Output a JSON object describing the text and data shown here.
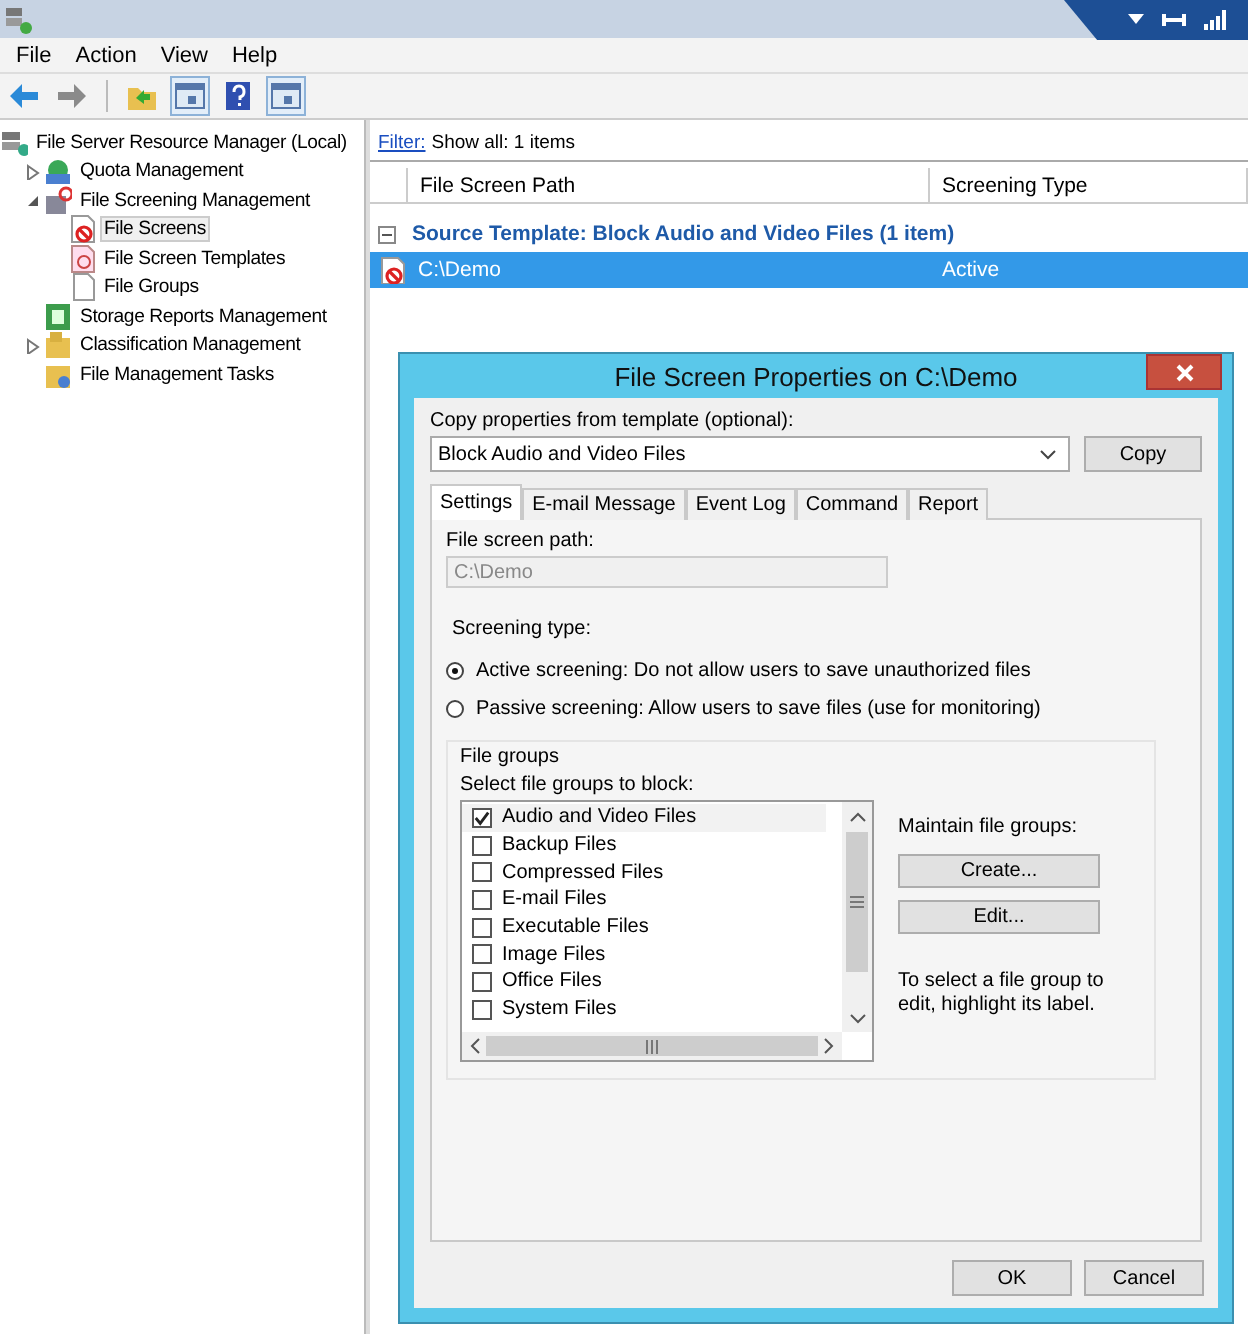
{
  "menu": [
    "File",
    "Action",
    "View",
    "Help"
  ],
  "toolbar": [
    {
      "kind": "back"
    },
    {
      "kind": "forward"
    },
    {
      "kind": "sep"
    },
    {
      "kind": "folder"
    },
    {
      "kind": "pane"
    },
    {
      "kind": "help"
    },
    {
      "kind": "pane"
    }
  ],
  "tree": [
    {
      "label": "File Server Resource Manager (Local)",
      "kind": "server",
      "selected": false,
      "children": [
        {
          "label": "Quota Management",
          "kind": "quota",
          "expanded": false,
          "selected": false
        },
        {
          "label": "File Screening Management",
          "kind": "screening",
          "expanded": true,
          "selected": false,
          "children": [
            {
              "label": "File Screens",
              "kind": "screen",
              "selected": true
            },
            {
              "label": "File Screen Templates",
              "kind": "template",
              "selected": false
            },
            {
              "label": "File Groups",
              "kind": "page",
              "selected": false
            }
          ]
        },
        {
          "label": "Storage Reports Management",
          "kind": "reports",
          "selected": false
        },
        {
          "label": "Classification Management",
          "kind": "classify",
          "expanded": false,
          "selected": false
        },
        {
          "label": "File Management Tasks",
          "kind": "tasks",
          "selected": false
        }
      ]
    }
  ],
  "filter": {
    "link": "Filter:",
    "text": "Show all: 1 items"
  },
  "table": {
    "columns": [
      "File Screen Path",
      "Screening Type"
    ],
    "group": {
      "label": "Source Template: Block Audio and Video Files (1 item)",
      "expanded": true
    },
    "rows": [
      {
        "path": "C:\\Demo",
        "type": "Active",
        "selected": true
      }
    ]
  },
  "dialog": {
    "title": "File Screen Properties on C:\\Demo",
    "template_label": "Copy properties from template (optional):",
    "template_value": "Block Audio and Video Files",
    "copy_button": "Copy",
    "tabs": [
      {
        "label": "Settings",
        "selected": true
      },
      {
        "label": "E-mail Message",
        "selected": false
      },
      {
        "label": "Event Log",
        "selected": false
      },
      {
        "label": "Command",
        "selected": false
      },
      {
        "label": "Report",
        "selected": false
      }
    ],
    "path_label": "File screen path:",
    "path_value": "C:\\Demo",
    "screening_label": "Screening type:",
    "screening_options": [
      {
        "label": "Active screening: Do not allow users to save unauthorized files",
        "selected": true
      },
      {
        "label": "Passive screening: Allow users to save files (use for monitoring)",
        "selected": false
      }
    ],
    "groups_title": "File groups",
    "groups_label": "Select file groups to block:",
    "file_groups": [
      {
        "label": "Audio and Video Files",
        "checked": true,
        "selected": true
      },
      {
        "label": "Backup Files",
        "checked": false,
        "selected": false
      },
      {
        "label": "Compressed Files",
        "checked": false,
        "selected": false
      },
      {
        "label": "E-mail Files",
        "checked": false,
        "selected": false
      },
      {
        "label": "Executable Files",
        "checked": false,
        "selected": false
      },
      {
        "label": "Image Files",
        "checked": false,
        "selected": false
      },
      {
        "label": "Office Files",
        "checked": false,
        "selected": false
      },
      {
        "label": "System Files",
        "checked": false,
        "selected": false
      }
    ],
    "maintain_label": "Maintain file groups:",
    "maintain_buttons": [
      "Create...",
      "Edit..."
    ],
    "hint": "To select a file group to edit, highlight its label.",
    "buttons": [
      "OK",
      "Cancel"
    ]
  }
}
